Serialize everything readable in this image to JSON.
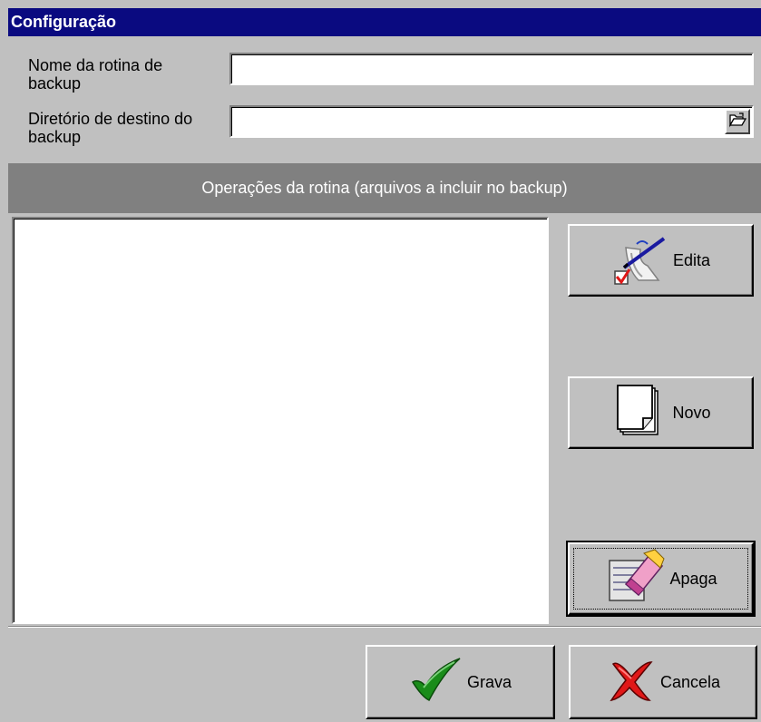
{
  "window": {
    "title": "Configuração"
  },
  "form": {
    "routine_name_label": "Nome da rotina de backup",
    "routine_name_value": "",
    "dest_dir_label": "Diretório de destino do backup",
    "dest_dir_value": ""
  },
  "operations": {
    "header": "Operações da rotina (arquivos a incluir no backup)",
    "items": []
  },
  "side_buttons": {
    "edit_label": "Edita",
    "new_label": "Novo",
    "delete_label": "Apaga"
  },
  "footer_buttons": {
    "save_label": "Grava",
    "cancel_label": "Cancela"
  },
  "colors": {
    "titlebar": "#0a0a80",
    "window_bg": "#c0c0c0",
    "section_header": "#808080",
    "save_check": "#1a8c1a",
    "cancel_x": "#e01818"
  },
  "icons": {
    "browse": "folder-open-icon",
    "edit": "edit-pen-check-icon",
    "new": "blank-page-icon",
    "delete": "eraser-icon",
    "save": "green-check-icon",
    "cancel": "red-x-icon"
  }
}
